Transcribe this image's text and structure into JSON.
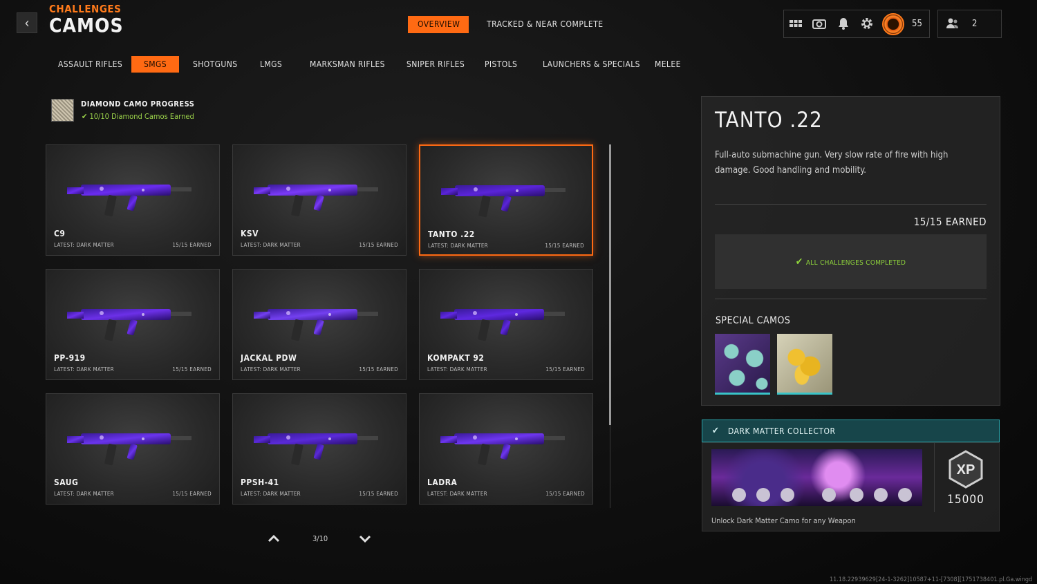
{
  "header": {
    "breadcrumb": "CHALLENGES",
    "title": "CAMOS",
    "back_icon": "chevron-left-icon",
    "tabs": [
      {
        "label": "OVERVIEW",
        "active": true
      },
      {
        "label": "TRACKED & NEAR COMPLETE",
        "active": false
      }
    ],
    "status_icons": [
      "grid-menu-icon",
      "camera-icon",
      "bell-icon",
      "gear-icon"
    ],
    "level": "55",
    "party_count": "2"
  },
  "categories": [
    {
      "label": "ASSAULT RIFLES",
      "active": false
    },
    {
      "label": "SMGS",
      "active": true
    },
    {
      "label": "SHOTGUNS",
      "active": false
    },
    {
      "label": "LMGS",
      "active": false
    },
    {
      "label": "MARKSMAN RIFLES",
      "active": false
    },
    {
      "label": "SNIPER RIFLES",
      "active": false
    },
    {
      "label": "PISTOLS",
      "active": false
    },
    {
      "label": "LAUNCHERS & SPECIALS",
      "active": false
    },
    {
      "label": "MELEE",
      "active": false
    }
  ],
  "progress": {
    "title": "DIAMOND CAMO PROGRESS",
    "subtitle": "10/10 Diamond Camos Earned"
  },
  "weapons": [
    {
      "name": "C9",
      "latest": "LATEST: DARK MATTER",
      "earned": "15/15 EARNED"
    },
    {
      "name": "KSV",
      "latest": "LATEST: DARK MATTER",
      "earned": "15/15 EARNED"
    },
    {
      "name": "TANTO .22",
      "latest": "LATEST: DARK MATTER",
      "earned": "15/15 EARNED",
      "selected": true
    },
    {
      "name": "PP-919",
      "latest": "LATEST: DARK MATTER",
      "earned": "15/15 EARNED"
    },
    {
      "name": "JACKAL PDW",
      "latest": "LATEST: DARK MATTER",
      "earned": "15/15 EARNED"
    },
    {
      "name": "KOMPAKT 92",
      "latest": "LATEST: DARK MATTER",
      "earned": "15/15 EARNED"
    },
    {
      "name": "SAUG",
      "latest": "LATEST: DARK MATTER",
      "earned": "15/15 EARNED"
    },
    {
      "name": "PPSH-41",
      "latest": "LATEST: DARK MATTER",
      "earned": "15/15 EARNED"
    },
    {
      "name": "LADRA",
      "latest": "LATEST: DARK MATTER",
      "earned": "15/15 EARNED"
    }
  ],
  "pager": {
    "text": "3/10"
  },
  "detail": {
    "name": "TANTO .22",
    "description": "Full-auto submachine gun.  Very slow rate of fire with high damage. Good handling and mobility.",
    "earned": "15/15 EARNED",
    "status": "ALL CHALLENGES COMPLETED",
    "special_label": "SPECIAL CAMOS"
  },
  "reward": {
    "title": "DARK MATTER COLLECTOR",
    "xp": "15000",
    "xp_label": "XP",
    "description": "Unlock Dark Matter Camo for any Weapon"
  },
  "build_string": "11.18.22939629[24-1-3262]10587+11-[7308][1751738401.pl.Ga.wingd",
  "colors": {
    "accent": "#ff6a13",
    "success": "#8fd43c",
    "reward_teal": "#17454a"
  }
}
